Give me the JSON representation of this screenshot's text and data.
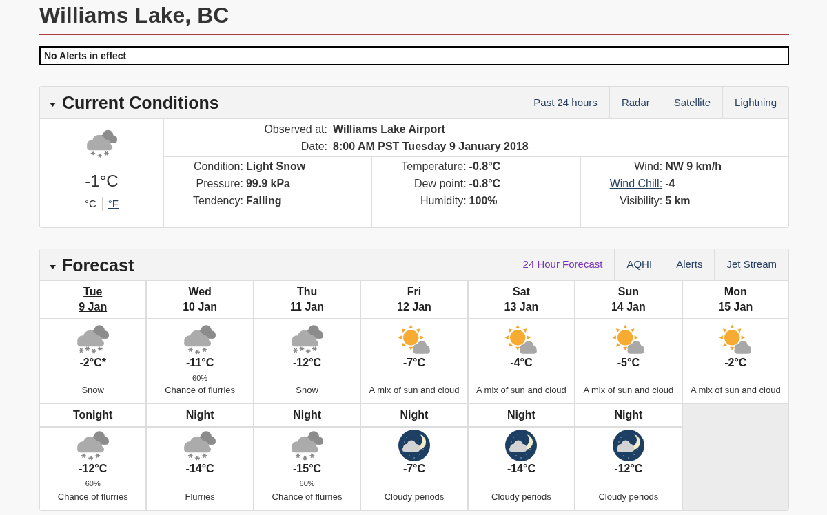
{
  "page_title": "Williams Lake, BC",
  "alert_banner": "No Alerts in effect",
  "current_conditions": {
    "title": "Current Conditions",
    "expanded": true,
    "links": [
      {
        "label": "Past 24 hours",
        "visited": false
      },
      {
        "label": "Radar",
        "visited": false
      },
      {
        "label": "Satellite",
        "visited": false
      },
      {
        "label": "Lightning",
        "visited": false
      }
    ],
    "kind": "flurries",
    "temperature": "-1°C",
    "units": [
      {
        "label": "°C",
        "selected": true
      },
      {
        "label": "°F",
        "selected": false
      }
    ],
    "station": [
      {
        "label": "Observed at:",
        "value": "Williams Lake Airport"
      },
      {
        "label": "Date:",
        "value": "8:00 AM PST Tuesday 9 January 2018"
      }
    ],
    "detail_columns": [
      {
        "items": [
          {
            "label": "Condition:",
            "value": "Light Snow",
            "link": false
          },
          {
            "label": "Pressure:",
            "value": "99.9 kPa",
            "link": false
          },
          {
            "label": "Tendency:",
            "value": "Falling",
            "link": false
          }
        ]
      },
      {
        "items": [
          {
            "label": "Temperature:",
            "value": "-0.8°C",
            "link": false
          },
          {
            "label": "Dew point:",
            "value": "-0.8°C",
            "link": false
          },
          {
            "label": "Humidity:",
            "value": "100%",
            "link": false
          }
        ]
      },
      {
        "items": [
          {
            "label": "Wind:",
            "value": "NW 9 km/h",
            "link": false
          },
          {
            "label": "Wind Chill:",
            "value": "-4",
            "link": true
          },
          {
            "label": "Visibility:",
            "value": "5 km",
            "link": false
          }
        ]
      }
    ]
  },
  "forecast": {
    "title": "Forecast",
    "expanded": true,
    "links": [
      {
        "label": "24 Hour Forecast",
        "visited": true
      },
      {
        "label": "AQHI",
        "visited": false
      },
      {
        "label": "Alerts",
        "visited": false
      },
      {
        "label": "Jet Stream",
        "visited": false
      }
    ],
    "days": [
      {
        "day": "Tue",
        "date": "9 Jan",
        "selected": true,
        "kind": "snow",
        "temperature": "-2°C*",
        "summary": "Snow"
      },
      {
        "day": "Wed",
        "date": "10 Jan",
        "selected": false,
        "kind": "flurries",
        "temperature": "-11°C",
        "pop": "60%",
        "summary": "Chance of flurries"
      },
      {
        "day": "Thu",
        "date": "11 Jan",
        "selected": false,
        "kind": "snow",
        "temperature": "-12°C",
        "summary": "Snow"
      },
      {
        "day": "Fri",
        "date": "12 Jan",
        "selected": false,
        "kind": "sun-cloud",
        "temperature": "-7°C",
        "summary": "A mix of sun and cloud"
      },
      {
        "day": "Sat",
        "date": "13 Jan",
        "selected": false,
        "kind": "sun-cloud",
        "temperature": "-4°C",
        "summary": "A mix of sun and cloud"
      },
      {
        "day": "Sun",
        "date": "14 Jan",
        "selected": false,
        "kind": "sun-cloud",
        "temperature": "-5°C",
        "summary": "A mix of sun and cloud"
      },
      {
        "day": "Mon",
        "date": "15 Jan",
        "selected": false,
        "kind": "sun-cloud",
        "temperature": "-2°C",
        "summary": "A mix of sun and cloud"
      }
    ],
    "nights": [
      {
        "label": "Tonight",
        "kind": "flurries",
        "temperature": "-12°C",
        "pop": "60%",
        "summary": "Chance of flurries"
      },
      {
        "label": "Night",
        "kind": "flurries",
        "temperature": "-14°C",
        "summary": "Flurries"
      },
      {
        "label": "Night",
        "kind": "flurries",
        "temperature": "-15°C",
        "pop": "60%",
        "summary": "Chance of flurries"
      },
      {
        "label": "Night",
        "kind": "night-cloud",
        "temperature": "-7°C",
        "summary": "Cloudy periods"
      },
      {
        "label": "Night",
        "kind": "night-cloud",
        "temperature": "-14°C",
        "summary": "Cloudy periods"
      },
      {
        "label": "Night",
        "kind": "night-cloud",
        "temperature": "-12°C",
        "summary": "Cloudy periods"
      }
    ]
  }
}
